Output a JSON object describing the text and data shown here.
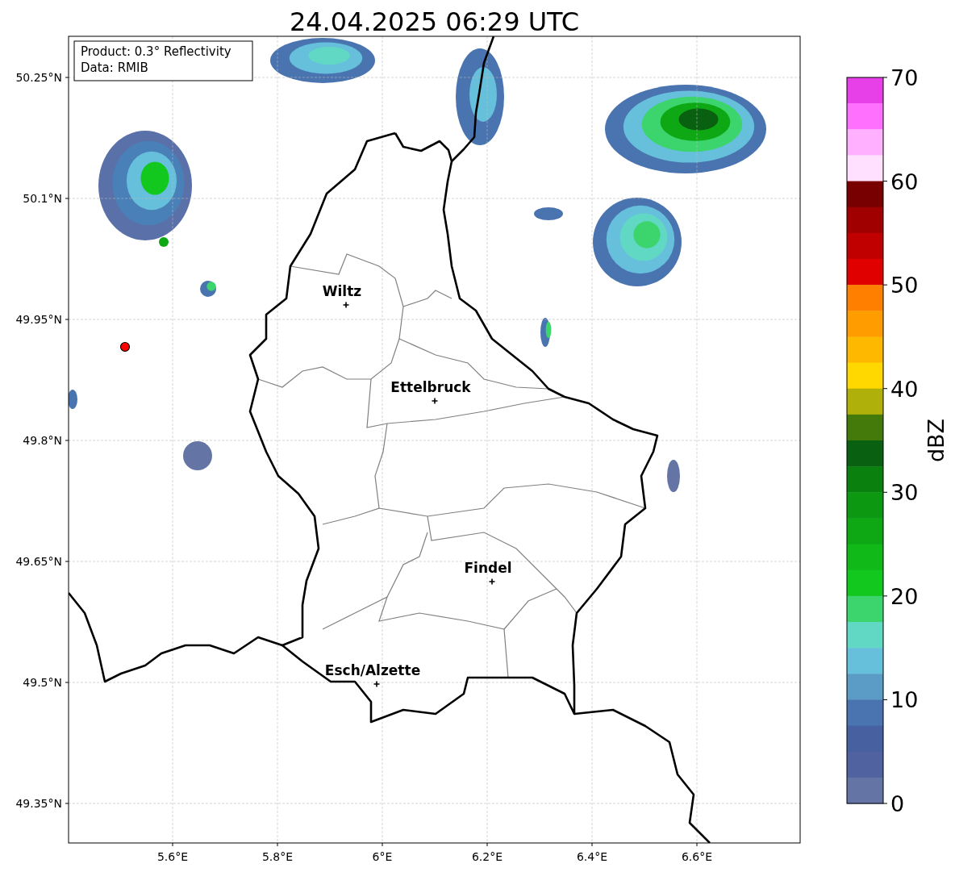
{
  "figure": {
    "title": "24.04.2025 06:29 UTC",
    "info_box": [
      "Product: 0.3° Reflectivity",
      "Data: RMIB"
    ],
    "map": {
      "y_labels": [
        "50.25°N",
        "50.1°N",
        "49.95°N",
        "49.8°N",
        "49.65°N",
        "49.5°N",
        "49.35°N"
      ],
      "x_labels": [
        "5.6°E",
        "5.8°E",
        "6°E",
        "6.2°E",
        "6.4°E",
        "6.6°E"
      ],
      "places": [
        {
          "name": "Wiltz"
        },
        {
          "name": "Ettelbruck"
        },
        {
          "name": "Findel"
        },
        {
          "name": "Esch/Alzette"
        }
      ]
    },
    "colorbar": {
      "label": "dBZ",
      "ticks": [
        "70",
        "60",
        "50",
        "40",
        "30",
        "20",
        "10",
        "0"
      ],
      "bands": [
        {
          "color": "#e840e8"
        },
        {
          "color": "#ff70ff"
        },
        {
          "color": "#ffb0ff"
        },
        {
          "color": "#ffe0ff"
        },
        {
          "color": "#780000"
        },
        {
          "color": "#a00000"
        },
        {
          "color": "#c00000"
        },
        {
          "color": "#e00000"
        },
        {
          "color": "#ff8000"
        },
        {
          "color": "#ff9c00"
        },
        {
          "color": "#ffb800"
        },
        {
          "color": "#ffd800"
        },
        {
          "color": "#b0b00a"
        },
        {
          "color": "#447a0a"
        },
        {
          "color": "#086010"
        },
        {
          "color": "#0a800e"
        },
        {
          "color": "#0c9810"
        },
        {
          "color": "#0ea814"
        },
        {
          "color": "#10b818"
        },
        {
          "color": "#12c81e"
        },
        {
          "color": "#3cd46c"
        },
        {
          "color": "#60d8c4"
        },
        {
          "color": "#66c0dc"
        },
        {
          "color": "#5a9cc6"
        },
        {
          "color": "#4a74b0"
        },
        {
          "color": "#4660a0"
        },
        {
          "color": "#5062a0"
        },
        {
          "color": "#6474a4"
        }
      ]
    }
  }
}
